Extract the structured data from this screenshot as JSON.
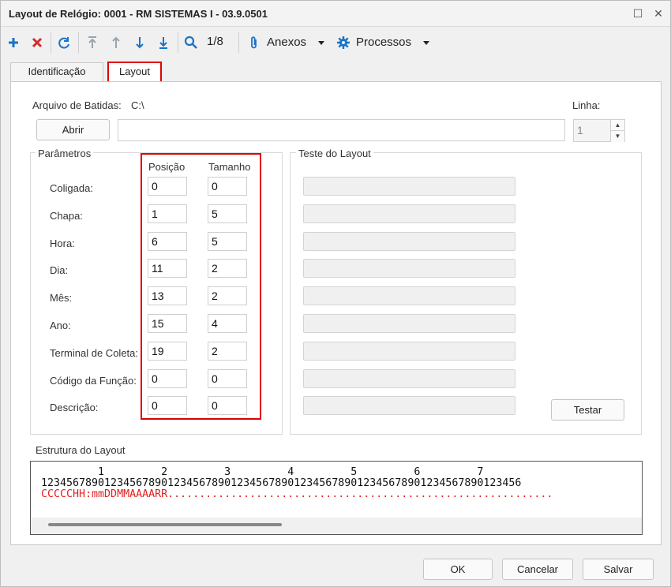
{
  "window": {
    "title": "Layout de Relógio: 0001 - RM SISTEMAS I - 03.9.0501",
    "maximize_glyph": "☐",
    "close_glyph": "✕"
  },
  "toolbar": {
    "record_position": "1/8",
    "anexos_label": "Anexos",
    "processos_label": "Processos",
    "icons": [
      "plus-icon",
      "delete-x-icon",
      "refresh-icon",
      "first-record-icon",
      "previous-record-icon",
      "next-record-icon",
      "last-record-icon",
      "search-icon",
      "paperclip-icon",
      "gear-icon"
    ]
  },
  "tabs": [
    {
      "label": "Identificação",
      "active": false
    },
    {
      "label": "Layout",
      "active": true
    }
  ],
  "file": {
    "label": "Arquivo de Batidas:",
    "path": "C:\\",
    "open_button": "Abrir",
    "path_input_value": "",
    "line_label": "Linha:",
    "line_value": "1"
  },
  "parametros": {
    "legend": "Parâmetros",
    "col_posicao": "Posição",
    "col_tamanho": "Tamanho",
    "rows": [
      {
        "label": "Coligada:",
        "posicao": "0",
        "tamanho": "0"
      },
      {
        "label": "Chapa:",
        "posicao": "1",
        "tamanho": "5"
      },
      {
        "label": "Hora:",
        "posicao": "6",
        "tamanho": "5"
      },
      {
        "label": "Dia:",
        "posicao": "11",
        "tamanho": "2"
      },
      {
        "label": "Mês:",
        "posicao": "13",
        "tamanho": "2"
      },
      {
        "label": "Ano:",
        "posicao": "15",
        "tamanho": "4"
      },
      {
        "label": "Terminal de Coleta:",
        "posicao": "19",
        "tamanho": "2"
      },
      {
        "label": "Código da Função:",
        "posicao": "0",
        "tamanho": "0"
      },
      {
        "label": "Descrição:",
        "posicao": "0",
        "tamanho": "0"
      }
    ]
  },
  "teste": {
    "legend": "Teste do Layout",
    "outputs": [
      "",
      "",
      "",
      "",
      "",
      "",
      "",
      "",
      ""
    ],
    "test_button": "Testar"
  },
  "estrutura": {
    "label": "Estrutura do Layout",
    "ruler_tens": "         1         2         3         4         5         6         7",
    "ruler_units": "1234567890123456789012345678901234567890123456789012345678901234567890123456",
    "layout_line": "CCCCCHH:mmDDMMAAAARR.............................................................",
    "layout_color": "#e02020"
  },
  "footer": {
    "ok": "OK",
    "cancel": "Cancelar",
    "save": "Salvar"
  },
  "colors": {
    "accent_blue": "#1a73c8",
    "delete_red": "#d42b2b",
    "highlight_red": "#e00000"
  }
}
